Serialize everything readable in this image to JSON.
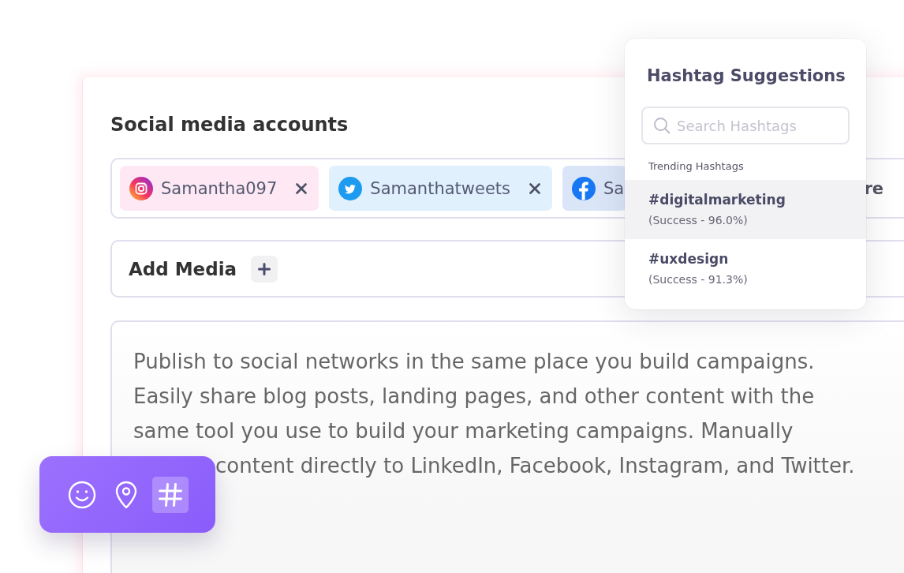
{
  "accounts": {
    "label": "Social media accounts",
    "chips": [
      {
        "kind": "instagram",
        "name": "Samantha097",
        "removable": true
      },
      {
        "kind": "twitter",
        "name": "Samanthatweets",
        "removable": true
      },
      {
        "kind": "facebook",
        "name": "Sa",
        "removable": false
      }
    ],
    "trailing_text": "re"
  },
  "add_media": {
    "label": "Add Media"
  },
  "post": {
    "text": "Publish to social networks in the same place you build campaigns. Easily share blog posts, landing pages, and other content with the same tool you use to build your marketing campaigns. Manually",
    "text_after_toolbar": "content directly to LinkedIn, Facebook, Instagram, and Twitter."
  },
  "toolbar": {
    "tools": [
      {
        "kind": "emoji",
        "selected": false
      },
      {
        "kind": "location",
        "selected": false
      },
      {
        "kind": "hashtag",
        "selected": true
      }
    ]
  },
  "hashtag_popup": {
    "title": "Hashtag Suggestions",
    "search": {
      "placeholder": "Search Hashtags"
    },
    "section_label": "Trending Hashtags",
    "items": [
      {
        "tag": "#digitalmarketing",
        "stat": "(Success - 96.0%)",
        "selected": true
      },
      {
        "tag": "#uxdesign",
        "stat": "(Success - 91.3%)",
        "selected": false
      }
    ]
  }
}
